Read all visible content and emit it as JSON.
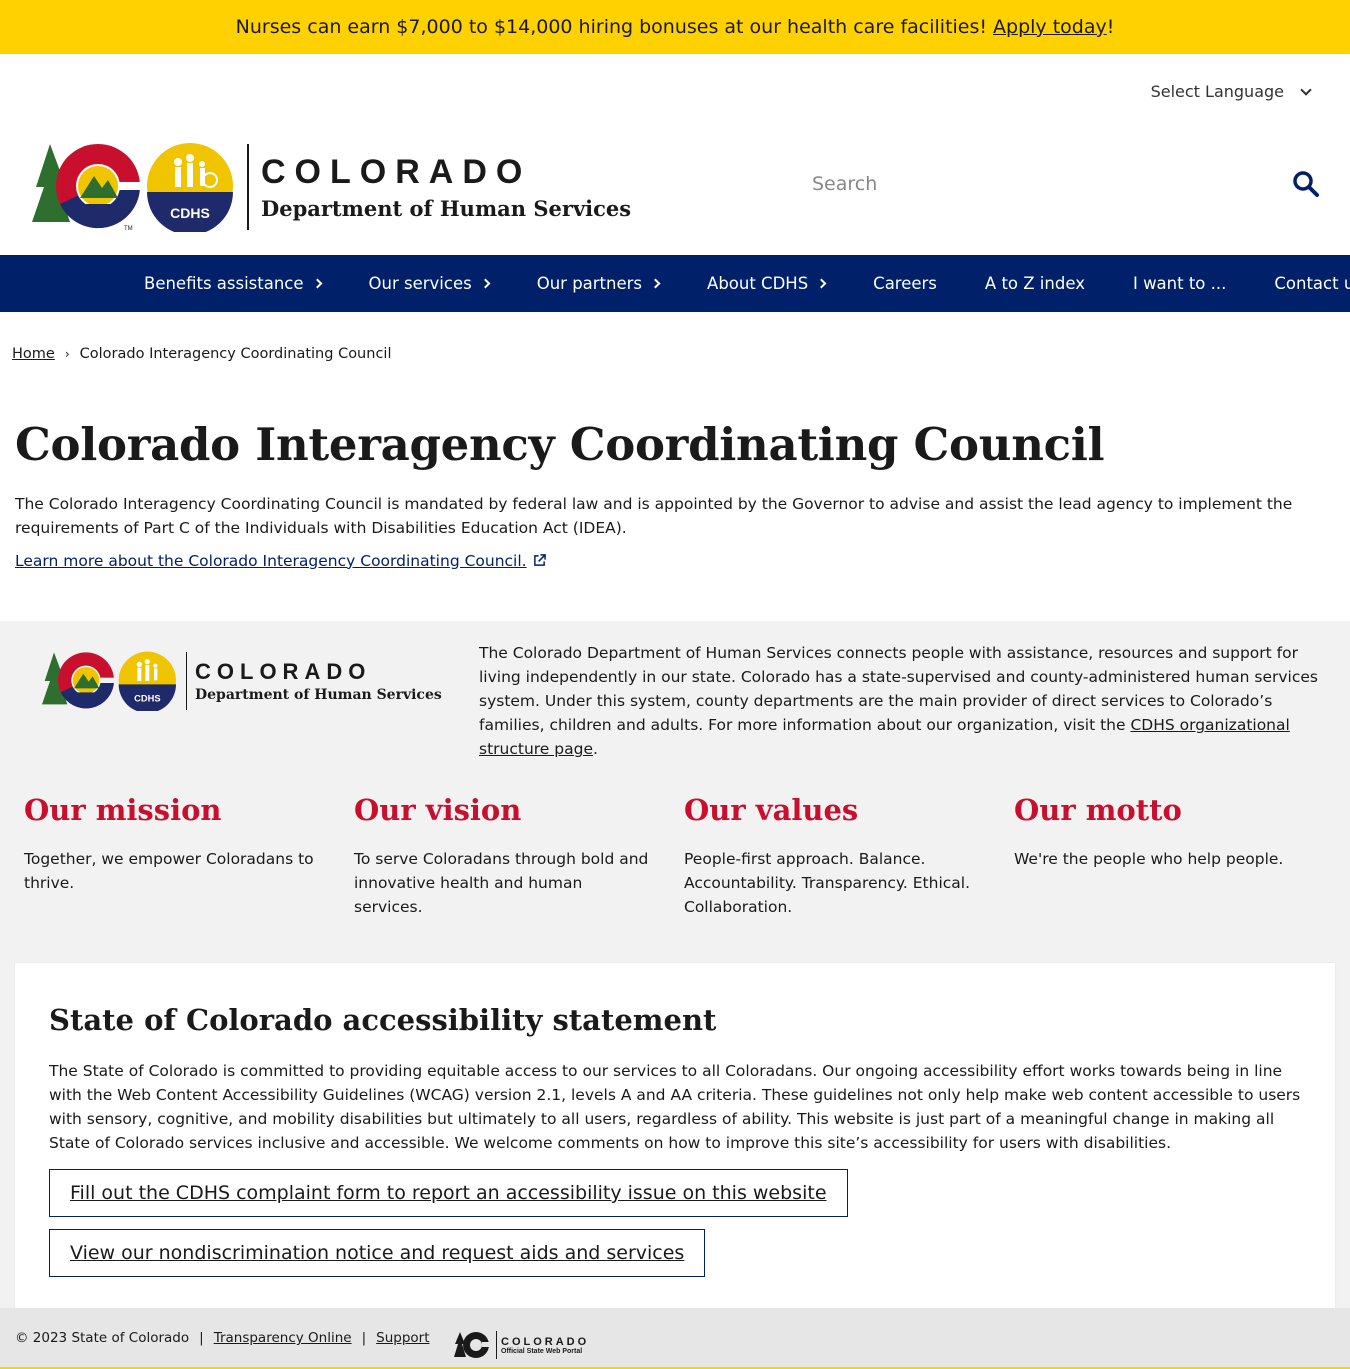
{
  "alert": {
    "text": "Nurses can earn $7,000 to $14,000 hiring bonuses at our health care facilities!",
    "link_label": "Apply today",
    "suffix": "!"
  },
  "language": {
    "label": "Select Language"
  },
  "header": {
    "logo_word": "COLORADO",
    "logo_sub": "Department of Human Services",
    "logo_badge": "CDHS",
    "logo_tm": "TM"
  },
  "search": {
    "placeholder": "Search"
  },
  "nav": {
    "items": [
      {
        "label": "Benefits assistance"
      },
      {
        "label": "Our services"
      },
      {
        "label": "Our partners"
      },
      {
        "label": "About CDHS"
      },
      {
        "label": "Careers"
      },
      {
        "label": "A to Z index"
      },
      {
        "label": "I want to ..."
      },
      {
        "label": "Contact us"
      }
    ]
  },
  "breadcrumb": {
    "home": "Home",
    "separator": "›",
    "current": "Colorado Interagency Coordinating Council"
  },
  "main": {
    "title": "Colorado Interagency Coordinating Council",
    "body": "The Colorado Interagency Coordinating Council is mandated by federal law and is appointed by the Governor to advise and assist the lead agency to implement the requirements of Part C of the Individuals with Disabilities Education Act (IDEA).",
    "link": "Learn more about the Colorado Interagency Coordinating Council."
  },
  "about": {
    "desc_before": "The Colorado Department of Human Services connects people with assistance, resources and support for living independently in our state. Colorado has a state-supervised and county-administered human services system. Under this system, county departments are the main provider of direct services to Colorado’s families, children and adults. For more information about our organization, visit the ",
    "desc_link": "CDHS organizational structure page",
    "desc_after": "."
  },
  "pillars": [
    {
      "title": "Our mission",
      "text": "Together, we empower Coloradans to thrive."
    },
    {
      "title": "Our vision",
      "text": "To serve Coloradans through bold and innovative health and human services."
    },
    {
      "title": "Our values",
      "text": "People-first approach. Balance. Accountability. Transparency. Ethical. Collaboration."
    },
    {
      "title": "Our motto",
      "text": "We're the people who help people."
    }
  ],
  "accessibility": {
    "title": "State of Colorado accessibility statement",
    "body": "The State of Colorado is committed to providing equitable access to our services to all Coloradans. Our ongoing accessibility effort works towards being in line with the Web Content Accessibility Guidelines (WCAG) version 2.1, levels A and AA criteria. These guidelines not only help make web content accessible to users with sensory, cognitive, and mobility disabilities but ultimately to all users, regardless of ability. This website is just part of a meaningful change in making all State of Colorado services inclusive and accessible. We welcome comments on how to improve this site’s accessibility for users with disabilities.",
    "button1": "Fill out the CDHS complaint form to report an accessibility issue on this website",
    "button2": "View our nondiscrimination notice and request aids and services"
  },
  "footer": {
    "copyright": "© 2023 State of Colorado",
    "sep": "|",
    "link1": "Transparency Online",
    "link2": "Support",
    "portal_word": "COLORADO",
    "portal_sub": "Official State Web Portal"
  },
  "colors": {
    "alert": "#ffd100",
    "nav": "#002169",
    "accent": "#c8102e",
    "gray_bg": "#f2f2f2"
  }
}
